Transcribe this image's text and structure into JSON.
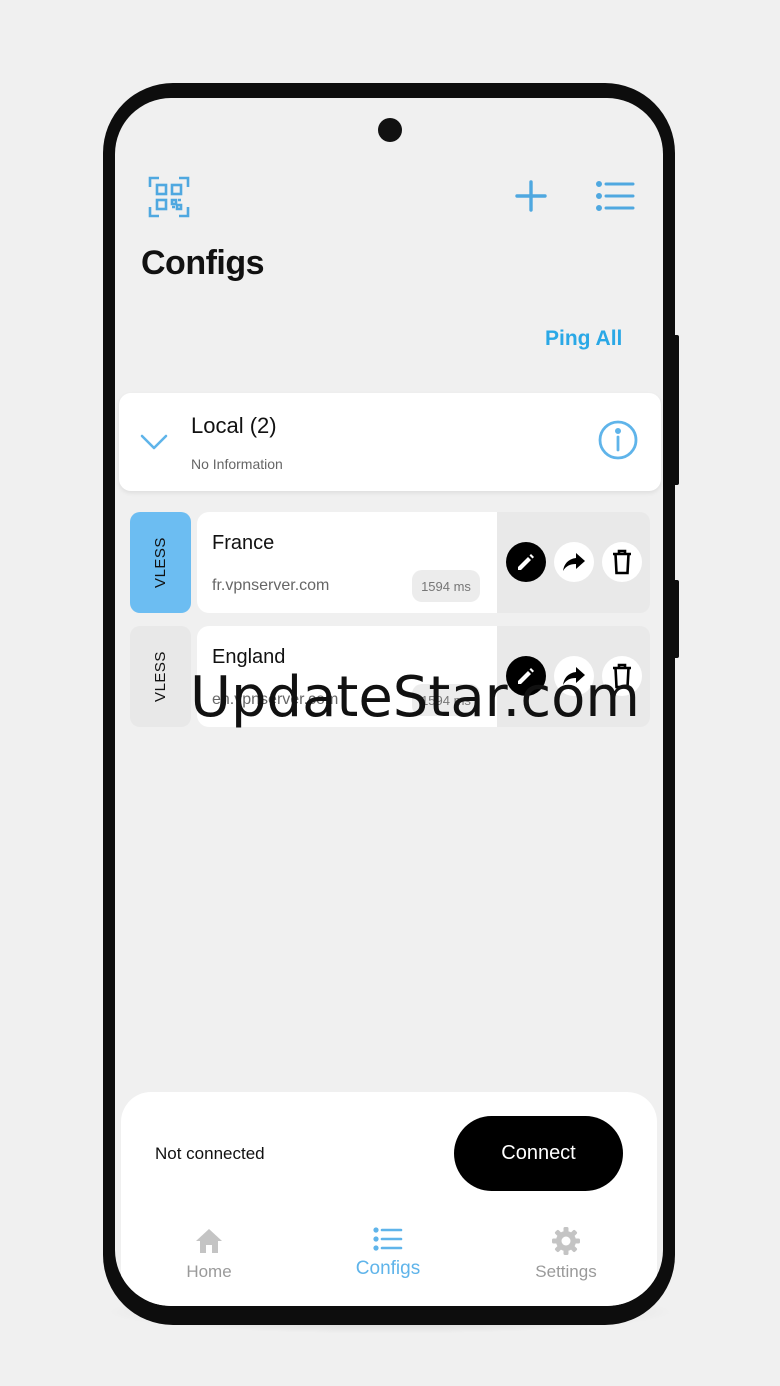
{
  "header": {
    "title": "Configs",
    "ping_all_label": "Ping All"
  },
  "group": {
    "title": "Local (2)",
    "subtitle": "No Information"
  },
  "configs": [
    {
      "protocol": "VLESS",
      "name": "France",
      "host": "fr.vpnserver.com",
      "ping": "1594 ms",
      "active": true
    },
    {
      "protocol": "VLESS",
      "name": "England",
      "host": "en.vpnserver.com",
      "ping": "1594 ms",
      "active": false
    }
  ],
  "connection": {
    "status": "Not connected",
    "button_label": "Connect"
  },
  "nav": {
    "home": "Home",
    "configs": "Configs",
    "settings": "Settings",
    "active": "configs"
  },
  "watermark": "UpdateStar.com",
  "colors": {
    "accent": "#2aa8e6",
    "active_tag": "#6cbdf2",
    "nav_active": "#5fb4ea"
  },
  "icons": [
    "qr-code-icon",
    "plus-icon",
    "list-menu-icon",
    "chevron-down-icon",
    "info-icon",
    "edit-icon",
    "share-icon",
    "delete-icon",
    "home-icon",
    "configs-list-icon",
    "gear-icon"
  ]
}
